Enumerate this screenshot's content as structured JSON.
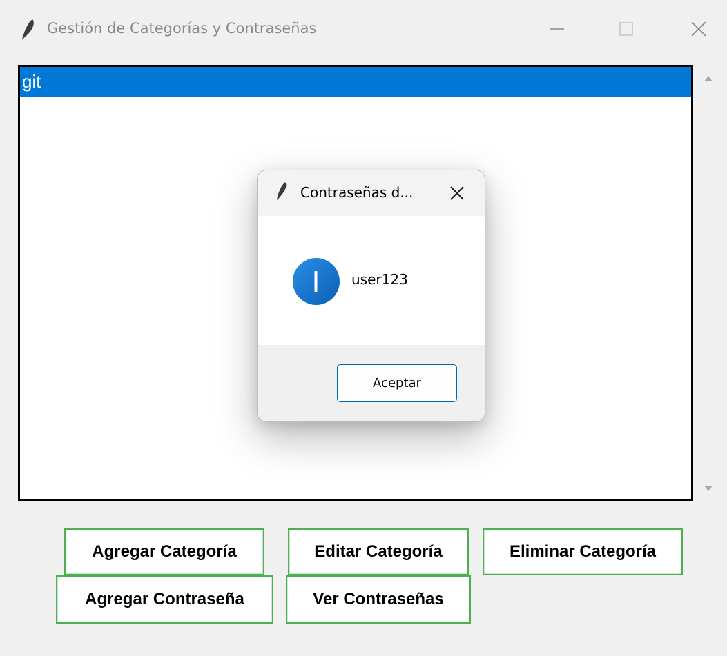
{
  "window": {
    "title": "Gestión de Categorías y Contraseñas",
    "icon": "feather-icon"
  },
  "listbox": {
    "items": [
      {
        "label": "git",
        "selected": true
      }
    ],
    "selection_color": "#0078d7"
  },
  "buttons": {
    "add_category": "Agregar Categoría",
    "edit_category": "Editar Categoría",
    "delete_category": "Eliminar Categoría",
    "add_password": "Agregar Contraseña",
    "view_passwords": "Ver Contraseñas",
    "border_color": "#4caf50"
  },
  "dialog": {
    "title": "Contraseñas d...",
    "icon": "info-icon",
    "message": "user123",
    "ok_label": "Aceptar",
    "accent_color": "#0067c0"
  }
}
